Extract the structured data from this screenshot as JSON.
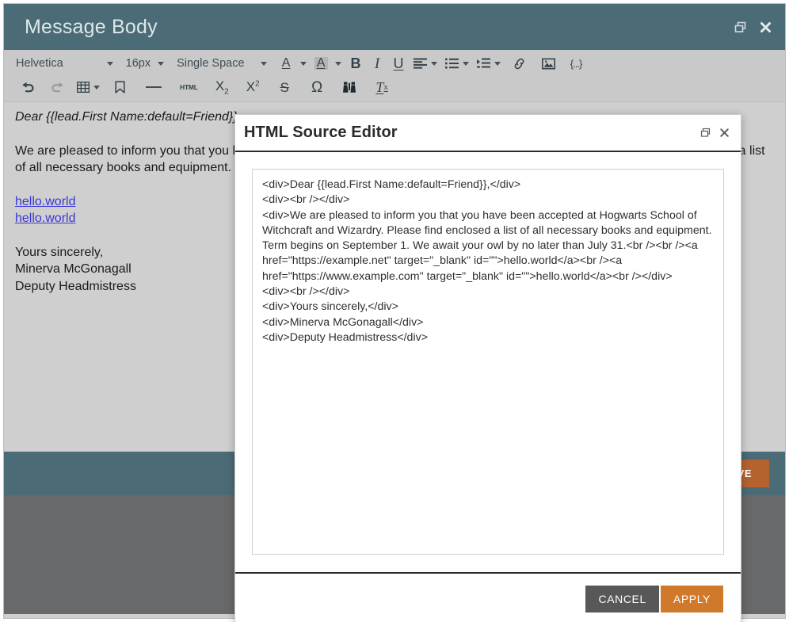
{
  "window": {
    "title": "Message Body",
    "restore_icon": "restore-window-icon",
    "close_icon": "close-icon"
  },
  "toolbar": {
    "row1": [
      {
        "name": "font-family-select",
        "label": "Helvetica",
        "type": "dropdown"
      },
      {
        "name": "font-size-select",
        "label": "16px",
        "type": "dropdown"
      },
      {
        "name": "line-spacing-select",
        "label": "Single Space",
        "type": "dropdown"
      },
      {
        "name": "text-color-button",
        "label": "A",
        "type": "color-dropdown"
      },
      {
        "name": "background-color-button",
        "label": "A",
        "type": "color-dropdown"
      },
      {
        "name": "bold-button",
        "label": "B",
        "type": "glyph"
      },
      {
        "name": "italic-button",
        "label": "I",
        "type": "glyph"
      },
      {
        "name": "underline-button",
        "label": "U",
        "type": "glyph"
      },
      {
        "name": "align-button",
        "label": "align-left-icon",
        "type": "icon-dropdown"
      },
      {
        "name": "list-button",
        "label": "bulleted-list-icon",
        "type": "icon-dropdown"
      },
      {
        "name": "indent-button",
        "label": "indent-icon",
        "type": "icon-dropdown"
      },
      {
        "name": "link-button",
        "label": "link-icon",
        "type": "icon"
      },
      {
        "name": "image-button",
        "label": "image-icon",
        "type": "icon"
      },
      {
        "name": "token-button",
        "label": "{...}",
        "type": "icon"
      }
    ],
    "row2": [
      {
        "name": "undo-button",
        "label": "undo-icon"
      },
      {
        "name": "redo-button",
        "label": "redo-icon"
      },
      {
        "name": "table-button",
        "label": "table-icon"
      },
      {
        "name": "bookmark-button",
        "label": "bookmark-icon"
      },
      {
        "name": "horizontal-rule-button",
        "label": "horizontal-rule-icon"
      },
      {
        "name": "html-source-button",
        "label": "HTML"
      },
      {
        "name": "subscript-button",
        "label": "subscript-icon"
      },
      {
        "name": "superscript-button",
        "label": "superscript-icon"
      },
      {
        "name": "strikethrough-button",
        "label": "strikethrough-icon"
      },
      {
        "name": "special-character-button",
        "label": "omega-icon"
      },
      {
        "name": "find-replace-button",
        "label": "binoculars-icon"
      },
      {
        "name": "clear-formatting-button",
        "label": "clear-formatting-icon"
      }
    ]
  },
  "document": {
    "greeting": "Dear {{lead.First Name:default=Friend}},",
    "paragraph": "We are pleased to inform you that you have been accepted at Hogwarts School of Witchcraft and Wizardry. Please find enclosed a list of all necessary books and equipment. Term begins on September 1. We await your owl by no later than July 31.",
    "link1": "hello.world",
    "link2": "hello.world",
    "signoff": "Yours sincerely,",
    "sender_name": "Minerva McGonagall",
    "sender_title": "Deputy Headmistress"
  },
  "footer": {
    "primary_button": "SAVE"
  },
  "dialog": {
    "title": "HTML Source Editor",
    "restore_icon": "restore-window-icon",
    "close_icon": "close-icon",
    "source": "<div>Dear {{lead.First Name:default=Friend}},</div>\n<div><br /></div>\n<div>We are pleased to inform you that you have been accepted at Hogwarts School of Witchcraft and Wizardry. Please find enclosed a list of all necessary books and equipment. Term begins on September 1. We await your owl by no later than July 31.<br /><br /><a href=\"https://example.net\" target=\"_blank\" id=\"\">hello.world</a><br /><a href=\"https://www.example.com\" target=\"_blank\" id=\"\">hello.world</a><br /></div>\n<div><br /></div>\n<div>Yours sincerely,</div>\n<div>Minerva McGonagall</div>\n<div>Deputy Headmistress</div>",
    "cancel_label": "CANCEL",
    "apply_label": "APPLY"
  },
  "colors": {
    "titlebar": "#4b6b76",
    "toolbar": "#c9c9c9",
    "canvas": "#cfcfcf",
    "accent_orange": "#d0792b",
    "footer_gray": "#68696a",
    "link": "#3a36d6"
  }
}
